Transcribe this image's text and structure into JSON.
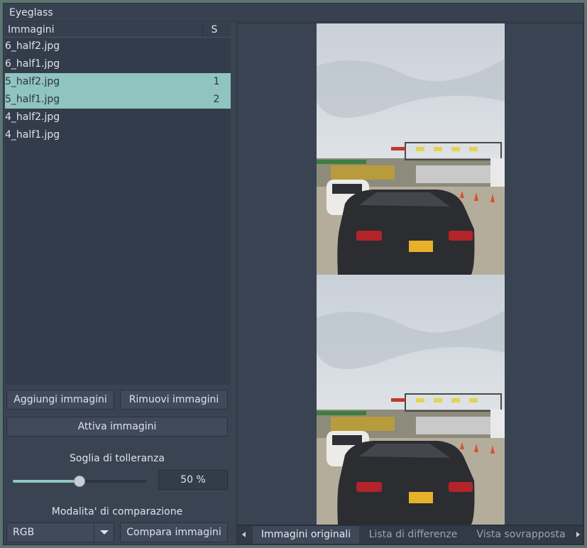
{
  "window": {
    "title": "Eyeglass"
  },
  "file_list": {
    "col_name": "Immagini",
    "col_selection": "S",
    "rows": [
      {
        "name": "6_half2.jpg",
        "selection": "",
        "active": false
      },
      {
        "name": "6_half1.jpg",
        "selection": "",
        "active": false
      },
      {
        "name": "5_half2.jpg",
        "selection": "1",
        "active": true
      },
      {
        "name": "5_half1.jpg",
        "selection": "2",
        "active": true
      },
      {
        "name": "4_half2.jpg",
        "selection": "",
        "active": false
      },
      {
        "name": "4_half1.jpg",
        "selection": "",
        "active": false
      }
    ]
  },
  "buttons": {
    "add": "Aggiungi immagini",
    "remove": "Rimuovi immagini",
    "activate": "Attiva immagini",
    "compare": "Compara immagini"
  },
  "tolerance": {
    "label": "Soglia di tolleranza",
    "value_text": "50 %",
    "value": 0.5
  },
  "compare_mode": {
    "label": "Modalita' di comparazione",
    "selected": "RGB"
  },
  "tabs": [
    {
      "label": "Immagini originali",
      "selected": true
    },
    {
      "label": "Lista di differenze",
      "selected": false
    },
    {
      "label": "Vista sovrapposta",
      "selected": false
    }
  ],
  "colors": {
    "accent": "#90c4bf",
    "background": "#3a4352"
  },
  "icons": {
    "dropdown": "chevron-down-icon",
    "tab_scroll_left": "arrow-left-icon",
    "tab_scroll_right": "arrow-right-icon"
  }
}
